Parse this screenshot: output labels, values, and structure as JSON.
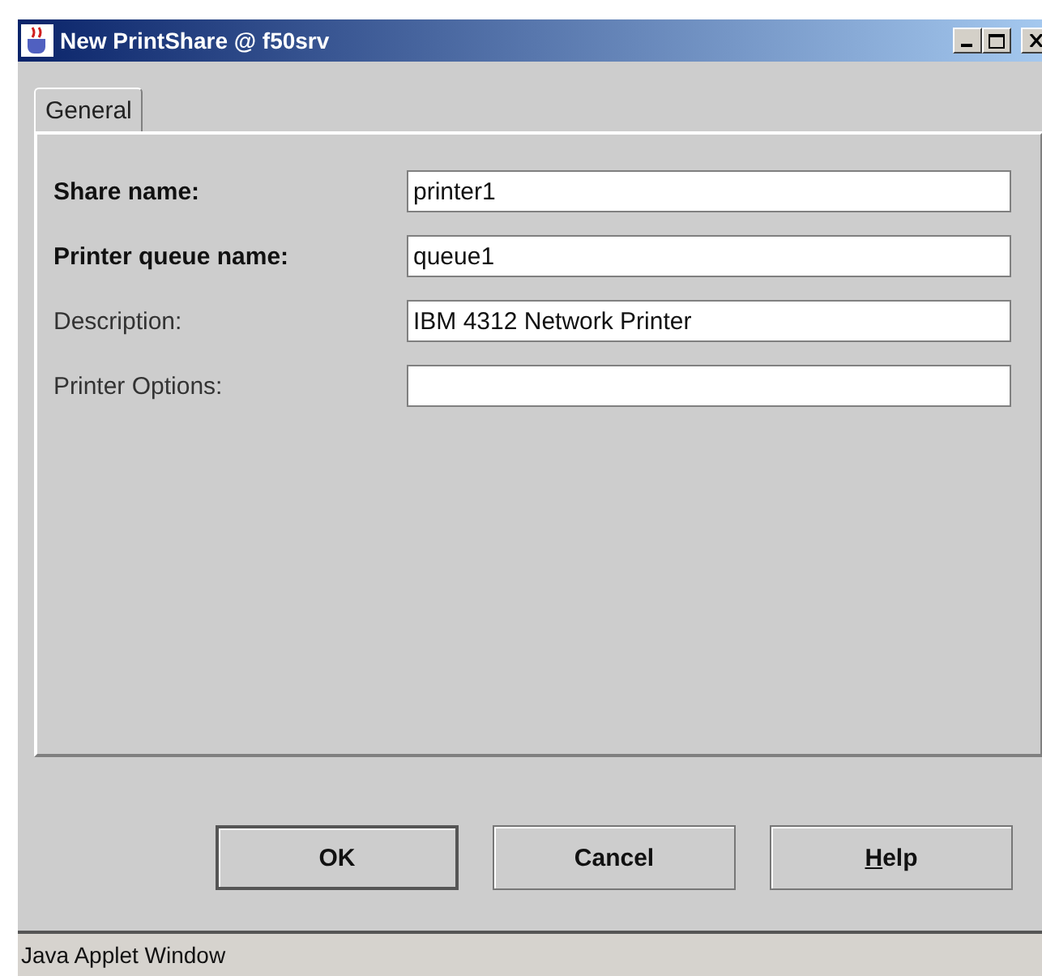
{
  "window": {
    "title": "New PrintShare @ f50srv"
  },
  "title_buttons": [
    {
      "kind": "minimize"
    },
    {
      "kind": "maximize"
    },
    {
      "kind": "close"
    }
  ],
  "tabs": [
    {
      "label": "General",
      "selected": true
    }
  ],
  "fields": [
    {
      "label": "Share name:",
      "value": "printer1",
      "required": true
    },
    {
      "label": "Printer queue name:",
      "value": "queue1",
      "required": true
    },
    {
      "label": "Description:",
      "value": "IBM 4312 Network Printer",
      "required": false
    },
    {
      "label": "Printer Options:",
      "required": false
    }
  ],
  "buttons": [
    {
      "label": "OK",
      "default": true,
      "mnemonic": false
    },
    {
      "label": "Cancel",
      "default": false,
      "mnemonic": false
    },
    {
      "label": "Help",
      "default": false,
      "mnemonic": true
    }
  ],
  "status_bar": "Java Applet Window"
}
